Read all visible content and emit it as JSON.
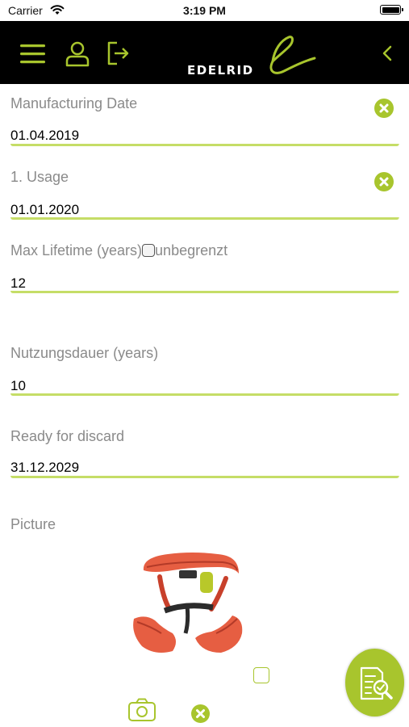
{
  "status_bar": {
    "carrier": "Carrier",
    "time": "3:19 PM"
  },
  "navbar": {
    "brand": "EDELRID",
    "icons": [
      "menu-icon",
      "user-icon",
      "logout-icon",
      "edelrid-logo-icon",
      "back-chevron-icon"
    ],
    "accent_color": "#a8c52d"
  },
  "fields": {
    "manufacturing_date": {
      "label": "Manufacturing Date",
      "value": "01.04.2019"
    },
    "first_usage": {
      "label": "1. Usage",
      "value": "01.01.2020"
    },
    "max_lifetime": {
      "label": "Max Lifetime (years)",
      "checkbox_label": "unbegrenzt",
      "value": "12"
    },
    "usage_duration": {
      "label": "Nutzungsdauer (years)",
      "value": "10"
    },
    "ready_for_discard": {
      "label": "Ready for discard",
      "value": "31.12.2029"
    }
  },
  "picture": {
    "label": "Picture",
    "image": "climbing-harness"
  },
  "colors": {
    "accent": "#a8c52d",
    "underline": "#c5dd67",
    "label": "#8a8a8a"
  }
}
